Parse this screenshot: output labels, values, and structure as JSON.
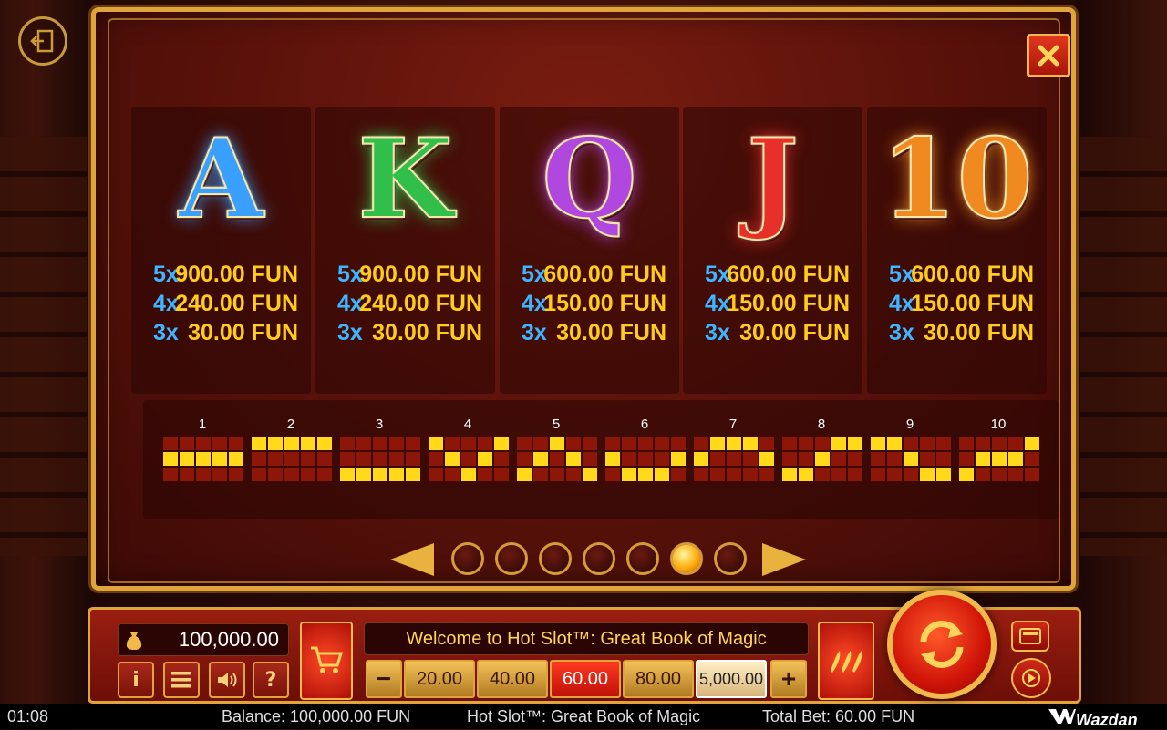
{
  "game": {
    "title": "Hot Slot™: Great Book of Magic"
  },
  "symbols": [
    {
      "name": "A",
      "color": "#3aa0ff",
      "pays": [
        {
          "mult": "5x",
          "amount": "900.00 FUN"
        },
        {
          "mult": "4x",
          "amount": "240.00 FUN"
        },
        {
          "mult": "3x",
          "amount": "30.00 FUN"
        }
      ]
    },
    {
      "name": "K",
      "color": "#2fbf4a",
      "pays": [
        {
          "mult": "5x",
          "amount": "900.00 FUN"
        },
        {
          "mult": "4x",
          "amount": "240.00 FUN"
        },
        {
          "mult": "3x",
          "amount": "30.00 FUN"
        }
      ]
    },
    {
      "name": "Q",
      "color": "#b048e0",
      "pays": [
        {
          "mult": "5x",
          "amount": "600.00 FUN"
        },
        {
          "mult": "4x",
          "amount": "150.00 FUN"
        },
        {
          "mult": "3x",
          "amount": "30.00 FUN"
        }
      ]
    },
    {
      "name": "J",
      "color": "#e8302a",
      "pays": [
        {
          "mult": "5x",
          "amount": "600.00 FUN"
        },
        {
          "mult": "4x",
          "amount": "150.00 FUN"
        },
        {
          "mult": "3x",
          "amount": "30.00 FUN"
        }
      ]
    },
    {
      "name": "10",
      "color": "#f08a20",
      "pays": [
        {
          "mult": "5x",
          "amount": "600.00 FUN"
        },
        {
          "mult": "4x",
          "amount": "150.00 FUN"
        },
        {
          "mult": "3x",
          "amount": "30.00 FUN"
        }
      ]
    }
  ],
  "paylines": [
    {
      "label": "1",
      "rows": [
        1,
        1,
        1,
        1,
        1
      ]
    },
    {
      "label": "2",
      "rows": [
        0,
        0,
        0,
        0,
        0
      ]
    },
    {
      "label": "3",
      "rows": [
        2,
        2,
        2,
        2,
        2
      ]
    },
    {
      "label": "4",
      "rows": [
        0,
        1,
        2,
        1,
        0
      ]
    },
    {
      "label": "5",
      "rows": [
        2,
        1,
        0,
        1,
        2
      ]
    },
    {
      "label": "6",
      "rows": [
        1,
        2,
        2,
        2,
        1
      ]
    },
    {
      "label": "7",
      "rows": [
        1,
        0,
        0,
        0,
        1
      ]
    },
    {
      "label": "8",
      "rows": [
        2,
        2,
        1,
        0,
        0
      ]
    },
    {
      "label": "9",
      "rows": [
        0,
        0,
        1,
        2,
        2
      ]
    },
    {
      "label": "10",
      "rows": [
        2,
        1,
        1,
        1,
        0
      ]
    }
  ],
  "pager": {
    "pages": 7,
    "active_page": 6
  },
  "controls": {
    "balance": "100,000.00",
    "message": "Welcome to Hot Slot™: Great Book of Magic",
    "minus_label": "−",
    "plus_label": "+",
    "info_label": "i",
    "help_label": "?",
    "bets": [
      "20.00",
      "40.00",
      "60.00",
      "80.00",
      "5,000.00"
    ],
    "selected_bet": "60.00"
  },
  "status_bar": {
    "clock": "01:08",
    "balance": "Balance: 100,000.00 FUN",
    "game_title": "Hot Slot™: Great Book of Magic",
    "total_bet": "Total Bet: 60.00 FUN",
    "brand": "Wazdan"
  },
  "icons": [
    "exit-icon",
    "close-icon",
    "money-bag-icon",
    "cart-icon",
    "info-icon",
    "menu-icon",
    "sound-icon",
    "help-icon",
    "chili-icon",
    "spin-icon",
    "autoplay-icon",
    "play-icon",
    "wazdan-logo-icon",
    "arrow-left-icon",
    "arrow-right-icon"
  ]
}
